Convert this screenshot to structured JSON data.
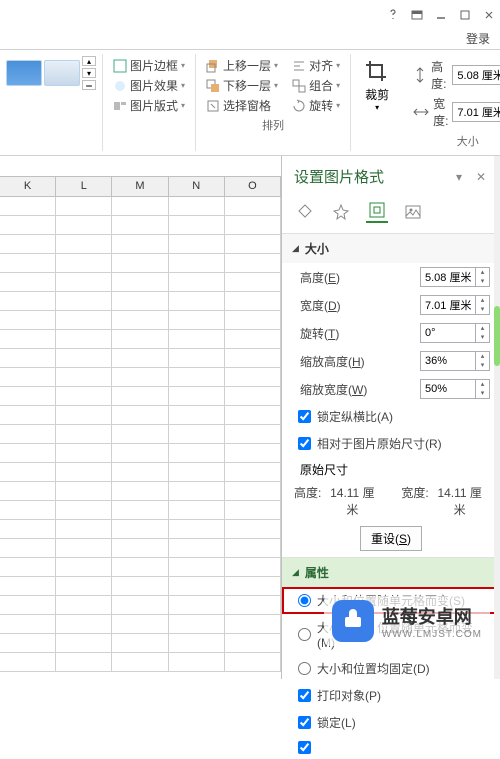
{
  "login": "登录",
  "ribbon": {
    "pic_border": "图片边框",
    "pic_effect": "图片效果",
    "pic_layout": "图片版式",
    "bring_forward": "上移一层",
    "send_backward": "下移一层",
    "select_pane": "选择窗格",
    "align": "对齐",
    "group": "组合",
    "rotate": "旋转",
    "arrange_label": "排列",
    "crop": "裁剪",
    "height_label": "高度:",
    "width_label": "宽度:",
    "height_value": "5.08 厘米",
    "width_value": "7.01 厘米",
    "size_label": "大小"
  },
  "columns": [
    "K",
    "L",
    "M",
    "N",
    "O"
  ],
  "panel": {
    "title": "设置图片格式",
    "size_section": "大小",
    "height": {
      "label": "高度(",
      "ul": "E",
      "suffix": ")",
      "value": "5.08 厘米"
    },
    "width": {
      "label": "宽度(",
      "ul": "D",
      "suffix": ")",
      "value": "7.01 厘米"
    },
    "rotation": {
      "label": "旋转(",
      "ul": "T",
      "suffix": ")",
      "value": "0°"
    },
    "scale_h": {
      "label": "缩放高度(",
      "ul": "H",
      "suffix": ")",
      "value": "36%"
    },
    "scale_w": {
      "label": "缩放宽度(",
      "ul": "W",
      "suffix": ")",
      "value": "50%"
    },
    "lock_aspect": {
      "label": "锁定纵横比(",
      "ul": "A",
      "suffix": ")"
    },
    "relative_orig": {
      "label": "相对于图片原始尺寸(",
      "ul": "R",
      "suffix": ")"
    },
    "orig_size_label": "原始尺寸",
    "orig_height_label": "高度:",
    "orig_height_value": "14.11 厘米",
    "orig_width_label": "宽度:",
    "orig_width_value": "14.11 厘米",
    "reset": {
      "label": "重设(",
      "ul": "S",
      "suffix": ")"
    },
    "attr_section": "属性",
    "move_size_cells": {
      "label": "大小和位置随单元格而变(",
      "ul": "S",
      "suffix": ")"
    },
    "move_no_size": {
      "label": "大小固定，位置随单元格而变(",
      "ul": "M",
      "suffix": ")"
    },
    "no_move": {
      "label": "大小和位置均固定(",
      "ul": "D",
      "suffix": ")"
    },
    "print": {
      "label": "打印对象(",
      "ul": "P",
      "suffix": ")"
    },
    "locked": {
      "label": "锁定(",
      "ul": "L",
      "suffix": ")"
    }
  },
  "watermark": {
    "cn": "蓝莓安卓网",
    "en": "WWW.LMJST.COM"
  }
}
